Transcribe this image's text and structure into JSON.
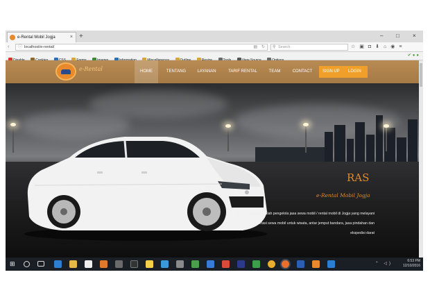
{
  "browser": {
    "tab_title": "e-Rental Mobil Jogja",
    "tab_close": "×",
    "new_tab": "+",
    "window_controls": [
      "–",
      "□",
      "×"
    ],
    "url": "localhost/e-rental/",
    "search_placeholder": "Search",
    "bookmarks": [
      {
        "label": "Disable",
        "color": "#d9362b"
      },
      {
        "label": "Cookies",
        "color": "#8a6a2a"
      },
      {
        "label": "CSS",
        "color": "#2b6fb5"
      },
      {
        "label": "Forms",
        "color": "#d6a43a"
      },
      {
        "label": "Images",
        "color": "#3a8a3a"
      },
      {
        "label": "Information",
        "color": "#2b6fb5"
      },
      {
        "label": "Miscellaneous",
        "color": "#d6a43a"
      },
      {
        "label": "Outline",
        "color": "#d6a43a"
      },
      {
        "label": "Resize",
        "color": "#d6a43a"
      },
      {
        "label": "Tools",
        "color": "#6a6a6a"
      },
      {
        "label": "View Source",
        "color": "#555555"
      },
      {
        "label": "Options",
        "color": "#6a6a6a"
      }
    ]
  },
  "site": {
    "logo_text": "e-Rental",
    "nav": [
      "HOME",
      "TENTANG",
      "LAYANAN",
      "TARIF RENTAL",
      "TEAM",
      "CONTACT"
    ],
    "signup": "SIGN UP",
    "login": "LOGIN",
    "hero_title": "RAS",
    "hero_tagline": "e-Rental Mobil Jogja",
    "hero_desc_lines": [
      "RAS Transport adalah pengelola jasa sewa mobil / rental mobil di Jogja yang melayani",
      "transportasi sewa mobil untuk wisata, antar jemput bandara, jasa pindahan dan",
      "ekspedisi darat"
    ],
    "brand_color": "#e08a2a",
    "header_color": "#b88b54"
  },
  "taskbar": {
    "time": "6:53 PM",
    "date": "12/10/2016"
  }
}
